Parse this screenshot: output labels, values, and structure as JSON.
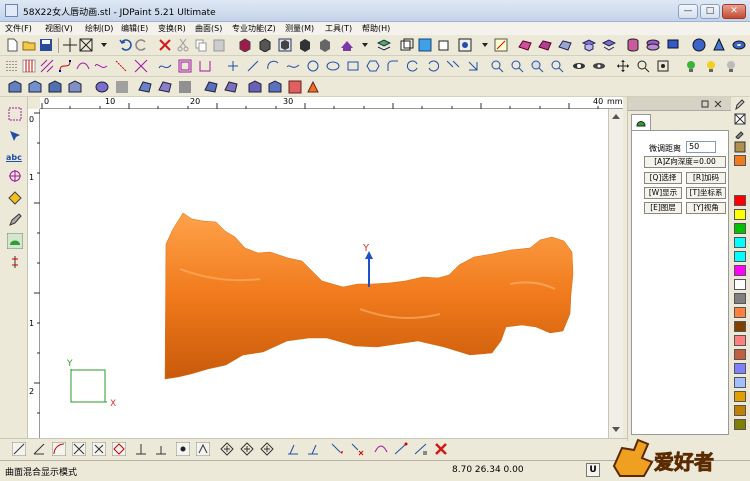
{
  "window": {
    "title": "58X22女人唇动画.stl - JDPaint 5.21 Ultimate",
    "min_label": "—",
    "max_label": "□",
    "close_label": "✕"
  },
  "menu": {
    "items": [
      {
        "label": "文件(F)"
      },
      {
        "label": "视图(V)"
      },
      {
        "label": "绘制(D)"
      },
      {
        "label": "编辑(E)"
      },
      {
        "label": "变换(R)"
      },
      {
        "label": "曲面(S)"
      },
      {
        "label": "专业功能(Z)"
      },
      {
        "label": "测量(M)"
      },
      {
        "label": "工具(T)"
      },
      {
        "label": "帮助(H)"
      }
    ]
  },
  "rulers": {
    "top_ticks": [
      "0",
      "10",
      "20",
      "30",
      "40"
    ],
    "top_unit": "mm",
    "left_ticks": [
      "0",
      "1",
      "1",
      "2"
    ]
  },
  "canvas": {
    "background": "#ffffff",
    "model_color": "#f07a1c",
    "axis_y_label": "Y",
    "axis_x_label": "X"
  },
  "right_panel": {
    "fine_tune_label": "微调距离",
    "fine_tune_value": "50",
    "z_depth_button": "[A]Z向深度=0.00",
    "buttons": [
      {
        "label": "[Q]选择"
      },
      {
        "label": "[R]加码"
      },
      {
        "label": "[W]显示"
      },
      {
        "label": "[T]坐标系"
      },
      {
        "label": "[E]图层"
      },
      {
        "label": "[Y]视角"
      }
    ]
  },
  "palette": {
    "colors": [
      "#ff0000",
      "#ffff00",
      "#00c000",
      "#00ffff",
      "#0000ff",
      "#ff00ff",
      "#ffffff",
      "#000000",
      "#808080",
      "#c0c0c0",
      "#ff8040",
      "#804000",
      "#ff8080",
      "#ff80ff",
      "#8080ff",
      "#80ffff",
      "#008080",
      "#008000",
      "#808000",
      "#c08000",
      "#804080",
      "#e0a000"
    ]
  },
  "status": {
    "mode": "曲面混合显示模式",
    "coords": "8.70 26.34 0.00",
    "unit_button": "U"
  },
  "brand": {
    "logo_text": "爱好者"
  }
}
